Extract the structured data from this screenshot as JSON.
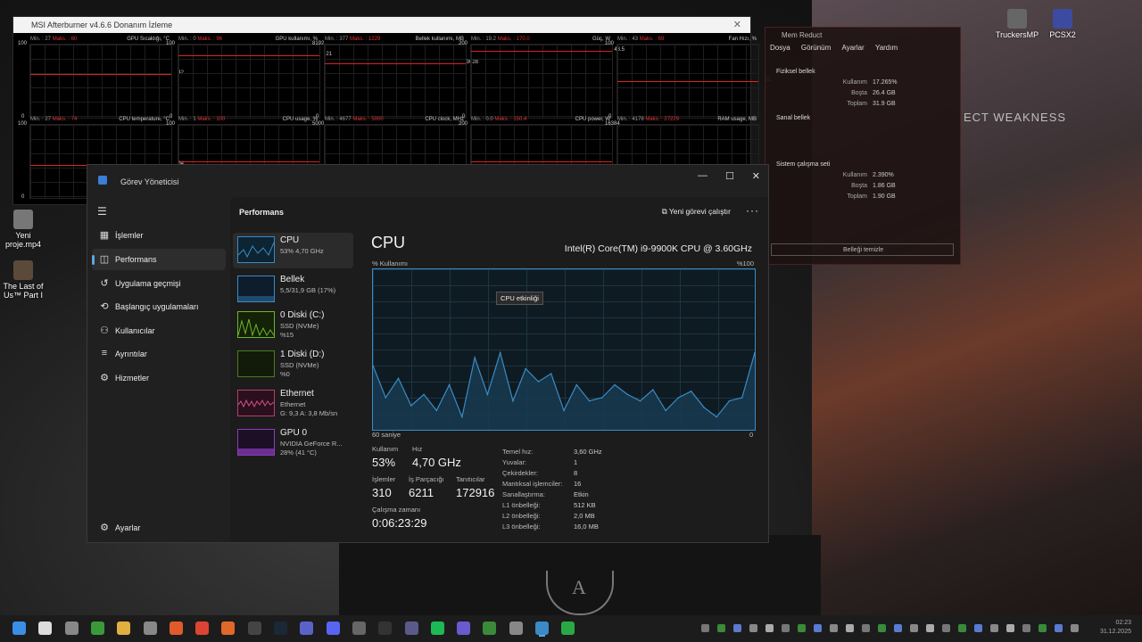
{
  "desktop": {
    "icons": [
      {
        "label": "Yeni proje.mp4"
      },
      {
        "label": "The Last of Us™ Part I"
      }
    ],
    "right_icons": [
      {
        "label": "TruckersMP"
      },
      {
        "label": "PCSX2"
      }
    ],
    "wallpaper_text": "ECT WEAKNESS",
    "emblem_letter": "A"
  },
  "afterburner": {
    "title": "MSI Afterburner v4.6.6 Donanım İzleme",
    "graphs": [
      {
        "name": "GPU Sıcaklığı, °C",
        "min": "Min. : 27",
        "max": "Maks. : 60",
        "current": "42",
        "top": "100",
        "bottom": "0"
      },
      {
        "name": "GPU kullanımı, %",
        "min": "Min. : 0",
        "max": "Maks. : 96",
        "current": "21",
        "top": "100",
        "bottom": "0"
      },
      {
        "name": "Bellek kullanımı, MB",
        "min": "Min. : 377",
        "max": "Maks. : 1229",
        "current": "3028",
        "top": "8192",
        "bottom": "0"
      },
      {
        "name": "Güç, W",
        "min": "Min. : 19.2",
        "max": "Maks. : 170.0",
        "current": "48.5",
        "top": "200",
        "bottom": "0"
      },
      {
        "name": "Fan Hızı, %",
        "min": "Min. : 43",
        "max": "Maks. : 69",
        "current": "51",
        "top": "100",
        "bottom": "0"
      },
      {
        "name": "CPU temperature, °C",
        "min": "Min. : 27",
        "max": "Maks. : 74",
        "current": "54",
        "top": "100",
        "bottom": "0"
      },
      {
        "name": "CPU usage, %",
        "min": "Min. : 1",
        "max": "Maks. : 100",
        "current": "",
        "top": "100",
        "bottom": "0"
      },
      {
        "name": "CPU clock, MHz",
        "min": "Min. : 4677",
        "max": "Maks. : 5000",
        "current": "4700",
        "top": "5000",
        "bottom": ""
      },
      {
        "name": "CPU power, W",
        "min": "Min. : 0.0",
        "max": "Maks. : 150.4",
        "current": "",
        "top": "200",
        "bottom": ""
      },
      {
        "name": "RAM usage, MB",
        "min": "Min. : 4178",
        "max": "Maks. : 27229",
        "current": "",
        "top": "16384",
        "bottom": ""
      }
    ]
  },
  "memreduct": {
    "title": "Mem Reduct",
    "menu": [
      "Dosya",
      "Görünüm",
      "Ayarlar",
      "Yardım"
    ],
    "physical": {
      "label": "Fiziksel bellek",
      "rows": [
        {
          "k": "Kullanım",
          "v": "17.265%"
        },
        {
          "k": "Boşta",
          "v": "26.4 GB"
        },
        {
          "k": "Toplam",
          "v": "31.9 GB"
        }
      ]
    },
    "virtual": {
      "label": "Sanal bellek"
    },
    "system": {
      "label": "Sistem çalışma seti",
      "rows": [
        {
          "k": "Kullanım",
          "v": "2.390%"
        },
        {
          "k": "Boşta",
          "v": "1.86 GB"
        },
        {
          "k": "Toplam",
          "v": "1.90 GB"
        }
      ]
    },
    "clean_button": "Belleği temizle"
  },
  "taskmanager": {
    "title": "Görev Yöneticisi",
    "nav": [
      {
        "label": "İşlemler",
        "icon": "grid-icon"
      },
      {
        "label": "Performans",
        "icon": "performance-icon"
      },
      {
        "label": "Uygulama geçmişi",
        "icon": "history-icon"
      },
      {
        "label": "Başlangıç uygulamaları",
        "icon": "startup-icon"
      },
      {
        "label": "Kullanıcılar",
        "icon": "users-icon"
      },
      {
        "label": "Ayrıntılar",
        "icon": "details-icon"
      },
      {
        "label": "Hizmetler",
        "icon": "services-icon"
      }
    ],
    "settings_label": "Ayarlar",
    "section_title": "Performans",
    "run_task": "Yeni görevi çalıştır",
    "resources": [
      {
        "name": "CPU",
        "l2": "53% 4,70 GHz",
        "l3": ""
      },
      {
        "name": "Bellek",
        "l2": "5,5/31,9 GB (17%)",
        "l3": ""
      },
      {
        "name": "0 Diski (C:)",
        "l2": "SSD (NVMe)",
        "l3": "%15"
      },
      {
        "name": "1 Diski (D:)",
        "l2": "SSD (NVMe)",
        "l3": "%0"
      },
      {
        "name": "Ethernet",
        "l2": "Ethernet",
        "l3": "G: 9,3 A: 3,8 Mb/sn"
      },
      {
        "name": "GPU 0",
        "l2": "NVIDIA GeForce R...",
        "l3": "28% (41 °C)"
      }
    ],
    "cpu": {
      "heading": "CPU",
      "model": "Intel(R) Core(TM) i9-9900K CPU @ 3.60GHz",
      "usage_label": "% Kullanımı",
      "max_label": "%100",
      "x_left": "60 saniye",
      "x_right": "0",
      "tooltip": "CPU etkinliği",
      "stats": {
        "usage_label": "Kullanım",
        "usage": "53%",
        "speed_label": "Hız",
        "speed": "4,70 GHz",
        "processes_label": "İşlemler",
        "processes": "310",
        "threads_label": "İş Parçacığı",
        "threads": "6211",
        "handles_label": "Tanıtıcılar",
        "handles": "172916",
        "uptime_label": "Çalışma zamanı",
        "uptime": "0:06:23:29"
      },
      "specs": [
        {
          "k": "Temel hız:",
          "v": "3,60 GHz"
        },
        {
          "k": "Yuvalar:",
          "v": "1"
        },
        {
          "k": "Çekirdekler:",
          "v": "8"
        },
        {
          "k": "Mantıksal işlemciler:",
          "v": "16"
        },
        {
          "k": "Sanallaştırma:",
          "v": "Etkin"
        },
        {
          "k": "L1 önbelleği:",
          "v": "512 KB"
        },
        {
          "k": "L2 önbelleği:",
          "v": "2,0 MB"
        },
        {
          "k": "L3 önbelleği:",
          "v": "16,0 MB"
        }
      ]
    }
  },
  "chart_data": {
    "type": "area",
    "x": [
      60,
      58,
      56,
      54,
      52,
      50,
      48,
      46,
      44,
      42,
      40,
      38,
      36,
      34,
      32,
      30,
      28,
      26,
      24,
      22,
      20,
      18,
      16,
      14,
      12,
      10,
      8,
      6,
      4,
      2,
      0
    ],
    "series": [
      {
        "values": [
          40,
          20,
          32,
          15,
          22,
          12,
          28,
          8,
          45,
          22,
          48,
          18,
          38,
          30,
          35,
          12,
          28,
          18,
          20,
          28,
          22,
          18,
          25,
          12,
          20,
          24,
          14,
          8,
          18,
          20,
          48
        ]
      }
    ],
    "ylim": [
      0,
      100
    ],
    "xlabel": "60 saniye",
    "ylabel": "% Kullanımı",
    "color": "#3a8bc5"
  },
  "taskbar": {
    "clock_time": "02:23",
    "clock_date": "31.12.2025"
  }
}
